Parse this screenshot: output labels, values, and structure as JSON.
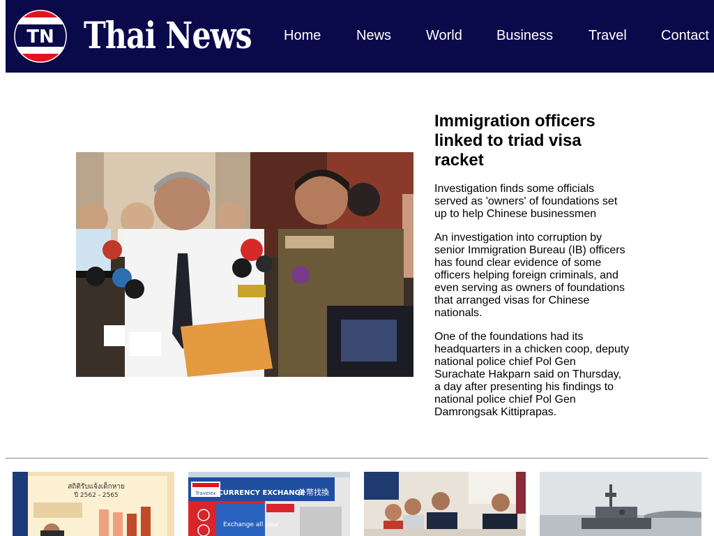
{
  "brand": {
    "logo_text": "TN",
    "name": "Thai News",
    "colors": {
      "header_bg": "#0a0a4a",
      "logo_red": "#e1141e",
      "text_on_header": "#ffffff"
    }
  },
  "nav": {
    "items": [
      {
        "label": "Home"
      },
      {
        "label": "News"
      },
      {
        "label": "World"
      },
      {
        "label": "Business"
      },
      {
        "label": "Travel"
      },
      {
        "label": "Contact"
      }
    ]
  },
  "hero": {
    "image_icon": "news-photo",
    "headline": "Immigration officers linked to triad visa racket",
    "standfirst": "Investigation finds some officials served as 'owners' of foundations set up to help Chinese businessmen",
    "paragraphs": [
      "An investigation into corruption by senior Immigration Bureau (IB) officers has found clear evidence of some officers helping foreign criminals, and even serving as owners of foundations that arranged visas for Chinese nationals.",
      "One of the foundations had its headquarters in a chicken coop, deputy national police chief Pol Gen Surachate Hakparn said on Thursday, a day after presenting his findings to national police chief Pol Gen Damrongsak Kittiprapas."
    ]
  },
  "thumbnails": [
    {
      "image_icon": "chart-poster-photo",
      "caption_lines": [
        "สถิติรับแจ้งเด็กหาย",
        "ปี 2562 - 2565"
      ]
    },
    {
      "image_icon": "currency-exchange-photo",
      "brand": "Travelex",
      "sign": "CURRENCY EXCHANGE",
      "sign_cn": "外幣找換",
      "panel": "Exchange all your"
    },
    {
      "image_icon": "press-conference-photo"
    },
    {
      "image_icon": "warship-photo"
    }
  ]
}
